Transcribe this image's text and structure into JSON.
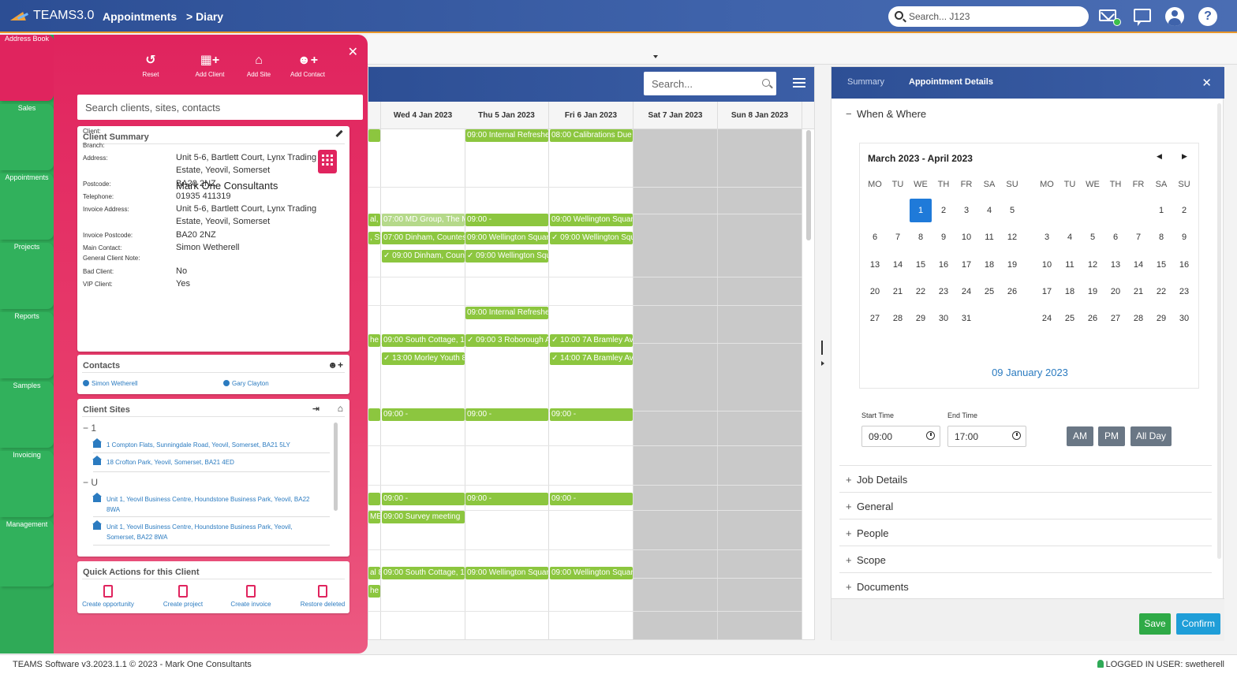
{
  "app": {
    "name": "TEAMS3.0",
    "breadcrumb": [
      "Appointments",
      "> Diary"
    ]
  },
  "header": {
    "search_placeholder": "Search... J123"
  },
  "nav": [
    {
      "label": "Address Book",
      "icon": "address-book-icon"
    },
    {
      "label": "Sales",
      "icon": "sales-icon"
    },
    {
      "label": "Appointments",
      "icon": "calendar-icon"
    },
    {
      "label": "Projects",
      "icon": "checklist-icon"
    },
    {
      "label": "Reports",
      "icon": "report-icon"
    },
    {
      "label": "Samples",
      "icon": "test-tube-icon"
    },
    {
      "label": "Invoicing",
      "icon": "coins-icon"
    },
    {
      "label": "Management",
      "icon": "pie-chart-icon"
    }
  ],
  "addressbook": {
    "tools": [
      "Reset",
      "Add Client",
      "Add Site",
      "Add Contact"
    ],
    "search_placeholder": "Search clients, sites, contacts",
    "summary": {
      "title": "Client Summary",
      "client_name": "Mark One Consultants",
      "rows": [
        {
          "label": "Client:",
          "value": ""
        },
        {
          "label": "Branch:",
          "value": ""
        },
        {
          "label": "Address:",
          "value": "Unit 5-6, Bartlett Court, Lynx Trading Estate, Yeovil, Somerset"
        },
        {
          "label": "Postcode:",
          "value": "BA20 2NZ"
        },
        {
          "label": "Telephone:",
          "value": "01935 411319"
        },
        {
          "label": "Invoice Address:",
          "value": "Unit 5-6, Bartlett Court, Lynx Trading Estate, Yeovil, Somerset"
        },
        {
          "label": "Invoice Postcode:",
          "value": "BA20 2NZ"
        },
        {
          "label": "Main Contact:",
          "value": "Simon Wetherell"
        },
        {
          "label": "General Client Note:",
          "value": ""
        },
        {
          "label": "Bad Client:",
          "value": "No"
        },
        {
          "label": "VIP Client:",
          "value": "Yes"
        }
      ]
    },
    "contacts": {
      "title": "Contacts",
      "items": [
        "Simon Wetherell",
        "Gary Clayton"
      ]
    },
    "sites": {
      "title": "Client Sites",
      "groups": [
        {
          "name": "1",
          "items": [
            "1 Compton Flats, Sunningdale Road, Yeovil, Somerset, BA21 5LY",
            "18 Crofton Park, Yeovil, Somerset, BA21 4ED"
          ]
        },
        {
          "name": "U",
          "items": [
            "Unit 1, Yeovil Business Centre, Houndstone Business Park, Yeovil, BA22 8WA",
            "Unit 1, Yeovil Business Centre, Houndstone Business Park, Yeovil, Somerset, BA22 8WA"
          ]
        }
      ]
    },
    "quick_actions": {
      "title": "Quick Actions for this Client",
      "items": [
        "Create opportunity",
        "Create project",
        "Create invoice",
        "Restore deleted"
      ]
    }
  },
  "diary": {
    "search_placeholder": "Search...",
    "days": [
      "Wed 4 Jan 2023",
      "Thu 5 Jan 2023",
      "Fri 6 Jan 2023",
      "Sat 7 Jan 2023",
      "Sun 8 Jan 2023"
    ],
    "events": [
      {
        "col": -1,
        "row": 0,
        "text": ""
      },
      {
        "col": 1,
        "row": 0,
        "text": "09:00 Internal Refreshe"
      },
      {
        "col": 2,
        "row": 0,
        "text": "08:00 Calibrations Due"
      },
      {
        "col": -1,
        "row": 1,
        "text": "al, St"
      },
      {
        "col": 0,
        "row": 1,
        "text": "07:00 MD Group, The M",
        "light": true
      },
      {
        "col": 1,
        "row": 1,
        "text": "09:00 -"
      },
      {
        "col": 2,
        "row": 1,
        "text": "09:00 Wellington Squar"
      },
      {
        "col": -1,
        "row": 2,
        "text": ", St"
      },
      {
        "col": 0,
        "row": 2,
        "text": "07:00 Dinham, Countes"
      },
      {
        "col": 1,
        "row": 2,
        "text": "09:00 Wellington Squar"
      },
      {
        "col": 2,
        "row": 2,
        "text": "✓ 09:00 Wellington Squ"
      },
      {
        "col": 0,
        "row": 3,
        "text": "✓ 09:00 Dinham, Count"
      },
      {
        "col": 1,
        "row": 3,
        "text": "✓ 09:00 Wellington Squ"
      },
      {
        "col": 1,
        "row": 4,
        "text": "09:00 Internal Refreshe"
      },
      {
        "col": -1,
        "row": 5,
        "text": "he"
      },
      {
        "col": 0,
        "row": 5,
        "text": "09:00 South Cottage, 1"
      },
      {
        "col": 1,
        "row": 5,
        "text": "✓ 09:00 3 Roborough A"
      },
      {
        "col": 2,
        "row": 5,
        "text": "✓ 10:00 7A Bramley Ave"
      },
      {
        "col": 0,
        "row": 6,
        "text": "✓ 13:00 Morley Youth 8"
      },
      {
        "col": 2,
        "row": 6,
        "text": "✓ 14:00 7A Bramley Ave"
      },
      {
        "col": -1,
        "row": 7,
        "text": ""
      },
      {
        "col": 0,
        "row": 7,
        "text": "09:00 -"
      },
      {
        "col": 1,
        "row": 7,
        "text": "09:00 -"
      },
      {
        "col": 2,
        "row": 7,
        "text": "09:00 -"
      },
      {
        "col": -1,
        "row": 8,
        "text": ""
      },
      {
        "col": 0,
        "row": 8,
        "text": "09:00 -"
      },
      {
        "col": 1,
        "row": 8,
        "text": "09:00 -"
      },
      {
        "col": 2,
        "row": 8,
        "text": "09:00 -"
      },
      {
        "col": -1,
        "row": 9,
        "text": "ME"
      },
      {
        "col": 0,
        "row": 9,
        "text": "09:00 Survey meeting"
      },
      {
        "col": -1,
        "row": 10,
        "text": "al 8"
      },
      {
        "col": 0,
        "row": 10,
        "text": "09:00 South Cottage, 1"
      },
      {
        "col": 1,
        "row": 10,
        "text": "09:00 Wellington Squar"
      },
      {
        "col": 2,
        "row": 10,
        "text": "09:00 Wellington Squar"
      },
      {
        "col": -1,
        "row": 11,
        "text": "he"
      }
    ]
  },
  "details": {
    "tabs": [
      "Summary",
      "Appointment Details"
    ],
    "when_where": "When & Where",
    "calendar": {
      "title": "March 2023 - April 2023",
      "dow": [
        "MO",
        "TU",
        "WE",
        "TH",
        "FR",
        "SA",
        "SU"
      ],
      "march": [
        [
          "",
          "",
          "1",
          "2",
          "3",
          "4",
          "5"
        ],
        [
          "6",
          "7",
          "8",
          "9",
          "10",
          "11",
          "12"
        ],
        [
          "13",
          "14",
          "15",
          "16",
          "17",
          "18",
          "19"
        ],
        [
          "20",
          "21",
          "22",
          "23",
          "24",
          "25",
          "26"
        ],
        [
          "27",
          "28",
          "29",
          "30",
          "31",
          "",
          ""
        ]
      ],
      "april": [
        [
          "",
          "",
          "",
          "",
          "",
          "1",
          "2"
        ],
        [
          "3",
          "4",
          "5",
          "6",
          "7",
          "8",
          "9"
        ],
        [
          "10",
          "11",
          "12",
          "13",
          "14",
          "15",
          "16"
        ],
        [
          "17",
          "18",
          "19",
          "20",
          "21",
          "22",
          "23"
        ],
        [
          "24",
          "25",
          "26",
          "27",
          "28",
          "29",
          "30"
        ]
      ],
      "selected": "1",
      "footer": "09 January 2023"
    },
    "start_label": "Start Time",
    "start_value": "09:00",
    "end_label": "End Time",
    "end_value": "17:00",
    "time_buttons": [
      "AM",
      "PM",
      "All Day"
    ],
    "sections": [
      "Job Details",
      "General",
      "People",
      "Scope",
      "Documents"
    ],
    "save": "Save",
    "confirm": "Confirm"
  },
  "status": {
    "left": "TEAMS Software v3.2023.1.1 © 2023 - Mark One Consultants",
    "right": "LOGGED IN USER: swetherell"
  },
  "colors": {
    "accent_pink": "#e0245e",
    "nav_green": "#2faa57",
    "event_green": "#8cc63f",
    "header_blue": "#3b5ea6"
  }
}
